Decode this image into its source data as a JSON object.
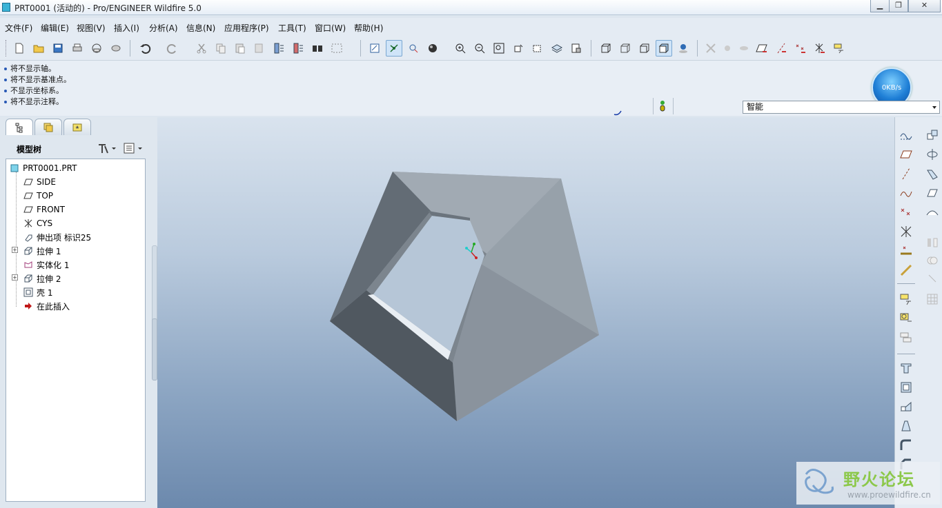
{
  "window": {
    "title": "PRT0001 (活动的) - Pro/ENGINEER Wildfire 5.0",
    "minimize_label": "▁",
    "restore_label": "❐",
    "close_label": "✕"
  },
  "menubar": {
    "items": [
      "文件(F)",
      "编辑(E)",
      "视图(V)",
      "插入(I)",
      "分析(A)",
      "信息(N)",
      "应用程序(P)",
      "工具(T)",
      "窗口(W)",
      "帮助(H)"
    ]
  },
  "messages": [
    "将不显示轴。",
    "将不显示基准点。",
    "不显示坐标系。",
    "将不显示注释。"
  ],
  "network_speed": "0KB/s",
  "selection_filter": {
    "value": "智能"
  },
  "navigator": {
    "tabs": [
      "model-tree-tab",
      "folder-browser-tab",
      "favorites-tab"
    ],
    "tree_title": "模型树",
    "items": [
      {
        "label": "PRT0001.PRT",
        "icon": "part-icon",
        "level": 0,
        "expandable": false
      },
      {
        "label": "SIDE",
        "icon": "datum-plane-icon",
        "level": 1,
        "expandable": false
      },
      {
        "label": "TOP",
        "icon": "datum-plane-icon",
        "level": 1,
        "expandable": false
      },
      {
        "label": "FRONT",
        "icon": "datum-plane-icon",
        "level": 1,
        "expandable": false
      },
      {
        "label": "CYS",
        "icon": "coordinate-system-icon",
        "level": 1,
        "expandable": false
      },
      {
        "label": "伸出项 标识25",
        "icon": "protrusion-icon",
        "level": 1,
        "expandable": false
      },
      {
        "label": "拉伸 1",
        "icon": "extrude-icon",
        "level": 1,
        "expandable": true
      },
      {
        "label": "实体化 1",
        "icon": "solidify-icon",
        "level": 1,
        "expandable": false
      },
      {
        "label": "拉伸 2",
        "icon": "extrude-icon",
        "level": 1,
        "expandable": true
      },
      {
        "label": "壳 1",
        "icon": "shell-icon",
        "level": 1,
        "expandable": false
      },
      {
        "label": "在此插入",
        "icon": "insert-here-arrow-icon",
        "level": 1,
        "expandable": false
      }
    ]
  },
  "watermark": {
    "text": "野火论坛",
    "url": "www.proewildfire.cn"
  },
  "colors": {
    "accent": "#2859b5",
    "graphics_top": "#d9e3ee",
    "graphics_bottom": "#6c89ad",
    "model_face": "#8f99a3"
  }
}
